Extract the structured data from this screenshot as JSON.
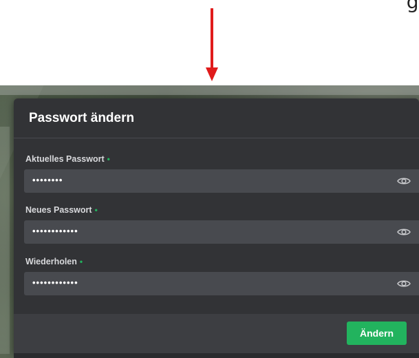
{
  "annotation": {
    "partial_text": "g"
  },
  "dialog": {
    "title": "Passwort ändern",
    "fields": [
      {
        "label": "Aktuelles Passwort",
        "required_mark": "•",
        "value": "••••••••"
      },
      {
        "label": "Neues Passwort",
        "required_mark": "•",
        "value": "••••••••••••"
      },
      {
        "label": "Wiederholen",
        "required_mark": "•",
        "value": "••••••••••••"
      }
    ],
    "submit_label": "Ändern"
  },
  "colors": {
    "accent": "#22b35e",
    "dialog_bg": "#323336",
    "field_bg": "#484a4f",
    "arrow": "#e01b1b"
  }
}
